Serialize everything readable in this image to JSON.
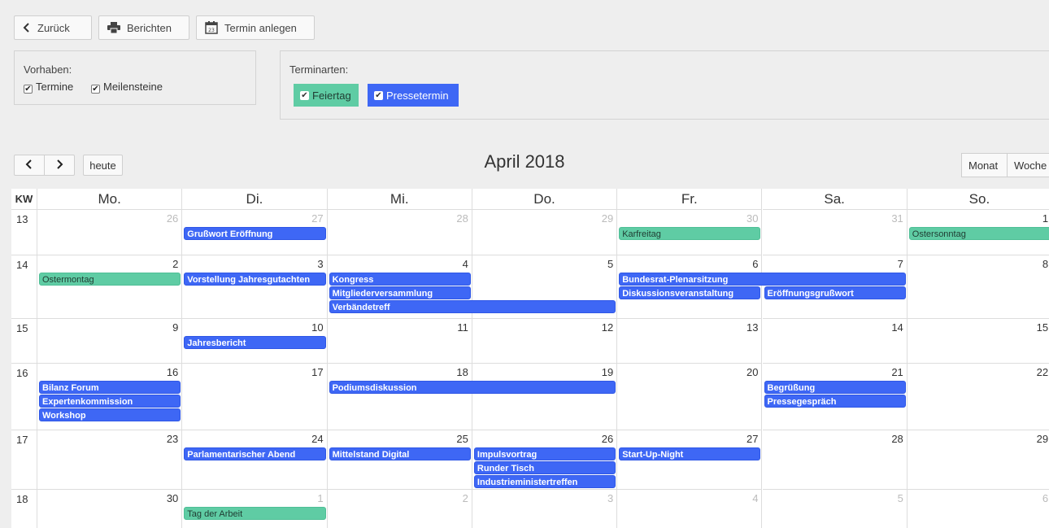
{
  "toolbar": {
    "back_label": "Zurück",
    "report_label": "Berichten",
    "create_label": "Termin anlegen"
  },
  "filters": {
    "vorhaben_label": "Vorhaben:",
    "termine_label": "Termine",
    "meilensteine_label": "Meilensteine",
    "terminarten_label": "Terminarten:",
    "feiertag_label": "Feiertag",
    "pressetermin_label": "Pressetermin",
    "colors": {
      "feiertag": "#5fcca4",
      "pressetermin": "#3e67f5"
    }
  },
  "calendar": {
    "title": "April 2018",
    "today_label": "heute",
    "views": {
      "month": "Monat",
      "week": "Woche"
    },
    "kw_header": "KW",
    "day_headers": [
      "Mo.",
      "Di.",
      "Mi.",
      "Do.",
      "Fr.",
      "Sa.",
      "So."
    ],
    "weeks": [
      {
        "kw": "13",
        "days": [
          "26",
          "27",
          "28",
          "29",
          "30",
          "31",
          "1"
        ],
        "other": [
          true,
          true,
          true,
          true,
          true,
          true,
          false
        ]
      },
      {
        "kw": "14",
        "days": [
          "2",
          "3",
          "4",
          "5",
          "6",
          "7",
          "8"
        ],
        "other": [
          false,
          false,
          false,
          false,
          false,
          false,
          false
        ]
      },
      {
        "kw": "15",
        "days": [
          "9",
          "10",
          "11",
          "12",
          "13",
          "14",
          "15"
        ],
        "other": [
          false,
          false,
          false,
          false,
          false,
          false,
          false
        ]
      },
      {
        "kw": "16",
        "days": [
          "16",
          "17",
          "18",
          "19",
          "20",
          "21",
          "22"
        ],
        "other": [
          false,
          false,
          false,
          false,
          false,
          false,
          false
        ]
      },
      {
        "kw": "17",
        "days": [
          "23",
          "24",
          "25",
          "26",
          "27",
          "28",
          "29"
        ],
        "other": [
          false,
          false,
          false,
          false,
          false,
          false,
          false
        ]
      },
      {
        "kw": "18",
        "days": [
          "30",
          "1",
          "2",
          "3",
          "4",
          "5",
          "6"
        ],
        "other": [
          false,
          true,
          true,
          true,
          true,
          true,
          true
        ]
      }
    ],
    "events": [
      {
        "title": "Grußwort Eröffnung",
        "week": 0,
        "start": 1,
        "span": 1,
        "slot": 0,
        "type": "pressetermin"
      },
      {
        "title": "Karfreitag",
        "week": 0,
        "start": 4,
        "span": 1,
        "slot": 0,
        "type": "feiertag"
      },
      {
        "title": "Ostersonntag",
        "week": 0,
        "start": 6,
        "span": 1,
        "slot": 0,
        "type": "feiertag"
      },
      {
        "title": "Ostermontag",
        "week": 1,
        "start": 0,
        "span": 1,
        "slot": 0,
        "type": "feiertag"
      },
      {
        "title": "Vorstellung Jahresgutachten",
        "week": 1,
        "start": 1,
        "span": 1,
        "slot": 0,
        "type": "pressetermin"
      },
      {
        "title": "Kongress",
        "week": 1,
        "start": 2,
        "span": 1,
        "slot": 0,
        "type": "pressetermin"
      },
      {
        "title": "Mitgliederversammlung",
        "week": 1,
        "start": 2,
        "span": 1,
        "slot": 1,
        "type": "pressetermin"
      },
      {
        "title": "Verbändetreff",
        "week": 1,
        "start": 2,
        "span": 2,
        "slot": 2,
        "type": "pressetermin"
      },
      {
        "title": "Bundesrat-Plenarsitzung",
        "week": 1,
        "start": 4,
        "span": 2,
        "slot": 0,
        "type": "pressetermin"
      },
      {
        "title": "Diskussionsveranstaltung",
        "week": 1,
        "start": 4,
        "span": 1,
        "slot": 1,
        "type": "pressetermin"
      },
      {
        "title": "Eröffnungsgrußwort",
        "week": 1,
        "start": 5,
        "span": 1,
        "slot": 1,
        "type": "pressetermin"
      },
      {
        "title": "Jahresbericht",
        "week": 2,
        "start": 1,
        "span": 1,
        "slot": 0,
        "type": "pressetermin"
      },
      {
        "title": "Bilanz Forum",
        "week": 3,
        "start": 0,
        "span": 1,
        "slot": 0,
        "type": "pressetermin"
      },
      {
        "title": "Expertenkommission",
        "week": 3,
        "start": 0,
        "span": 1,
        "slot": 1,
        "type": "pressetermin"
      },
      {
        "title": "Workshop",
        "week": 3,
        "start": 0,
        "span": 1,
        "slot": 2,
        "type": "pressetermin"
      },
      {
        "title": "Podiumsdiskussion",
        "week": 3,
        "start": 2,
        "span": 2,
        "slot": 0,
        "type": "pressetermin"
      },
      {
        "title": "Begrüßung",
        "week": 3,
        "start": 5,
        "span": 1,
        "slot": 0,
        "type": "pressetermin"
      },
      {
        "title": "Pressegespräch",
        "week": 3,
        "start": 5,
        "span": 1,
        "slot": 1,
        "type": "pressetermin"
      },
      {
        "title": "Parlamentarischer Abend",
        "week": 4,
        "start": 1,
        "span": 1,
        "slot": 0,
        "type": "pressetermin"
      },
      {
        "title": "Mittelstand Digital",
        "week": 4,
        "start": 2,
        "span": 1,
        "slot": 0,
        "type": "pressetermin"
      },
      {
        "title": "Impulsvortrag",
        "week": 4,
        "start": 3,
        "span": 1,
        "slot": 0,
        "type": "pressetermin"
      },
      {
        "title": "Runder Tisch",
        "week": 4,
        "start": 3,
        "span": 1,
        "slot": 1,
        "type": "pressetermin"
      },
      {
        "title": "Industrieministertreffen",
        "week": 4,
        "start": 3,
        "span": 1,
        "slot": 2,
        "type": "pressetermin"
      },
      {
        "title": "Start-Up-Night",
        "week": 4,
        "start": 4,
        "span": 1,
        "slot": 0,
        "type": "pressetermin"
      },
      {
        "title": "Tag der Arbeit",
        "week": 5,
        "start": 1,
        "span": 1,
        "slot": 0,
        "type": "feiertag"
      }
    ]
  }
}
